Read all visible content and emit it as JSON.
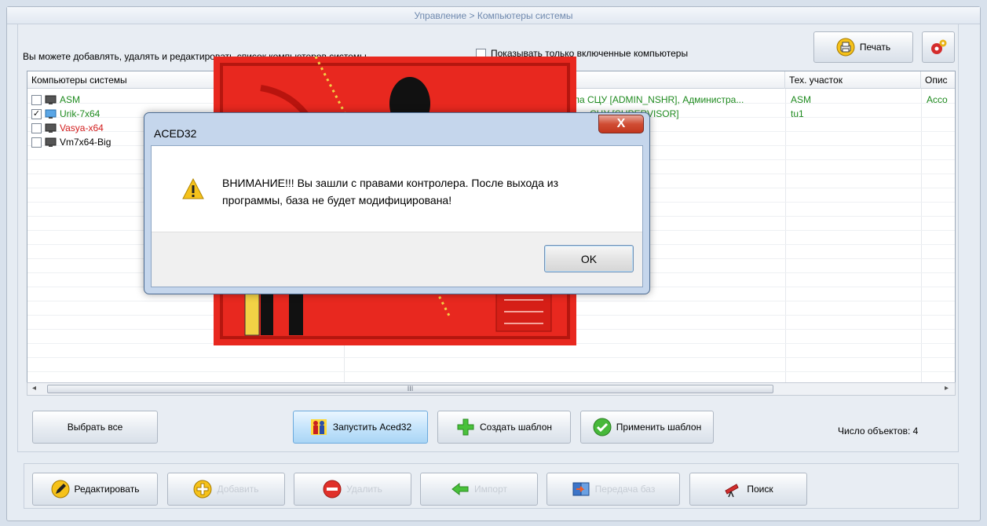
{
  "window": {
    "breadcrumb": "Управление > Компьютеры системы"
  },
  "toolbar": {
    "info_text": "Вы можете добавлять, удалять и редактировать список компьютеров системы",
    "filter_label": "Показывать только включенные компьютеры",
    "print_label": "Печать"
  },
  "grid": {
    "columns": [
      "Компьютеры системы",
      "",
      "Тех. участок",
      "Опис"
    ],
    "rows": [
      {
        "name": "ASM",
        "checked": false,
        "users": "ла СЦУ [ADMIN_NSHR], Администра...",
        "section": "ASM",
        "desc": "Acco"
      },
      {
        "name": "Urik-7x64",
        "checked": true,
        "users": "СЦУ [SUPERVISOR]",
        "section": "tu1",
        "desc": ""
      },
      {
        "name": "Vasya-x64",
        "checked": false,
        "users": "",
        "section": "",
        "desc": ""
      },
      {
        "name": "Vm7x64-Big",
        "checked": false,
        "users": "",
        "section": "",
        "desc": ""
      }
    ],
    "scroll_grip": "III"
  },
  "actions": {
    "select_all": "Выбрать все",
    "launch": "Запустить Aced32",
    "create_template": "Создать шаблон",
    "apply_template": "Применить шаблон",
    "count_text": "Число объектов: 4"
  },
  "bottom": {
    "edit": "Редактировать",
    "add": "Добавить",
    "delete": "Удалить",
    "import": "Импорт",
    "transfer": "Передача баз",
    "search": "Поиск"
  },
  "dialog": {
    "title": "ACED32",
    "close_glyph": "X",
    "message": "ВНИМАНИЕ!!! Вы зашли с правами контролера. После выхода из программы, база не будет модифицирована!",
    "ok": "OK"
  },
  "colors": {
    "online": "#1e8a1e",
    "error": "#d21c1c",
    "accent": "#6f89ae",
    "splash": "#e8281f"
  }
}
